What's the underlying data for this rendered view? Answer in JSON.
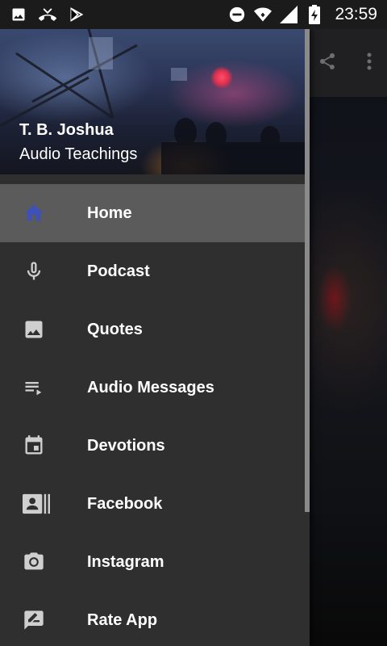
{
  "status_bar": {
    "time": "23:59",
    "left_icons": [
      "image-icon",
      "missed-call-icon",
      "play-store-icon"
    ],
    "right_icons": [
      "do-not-disturb-icon",
      "wifi-icon",
      "cell-signal-icon",
      "battery-charging-icon"
    ]
  },
  "drawer": {
    "header": {
      "title": "T. B. Joshua",
      "subtitle": "Audio Teachings"
    },
    "items": [
      {
        "label": "Home",
        "icon": "home-icon",
        "active": true
      },
      {
        "label": "Podcast",
        "icon": "microphone-icon",
        "active": false
      },
      {
        "label": "Quotes",
        "icon": "image-icon",
        "active": false
      },
      {
        "label": "Audio Messages",
        "icon": "playlist-play-icon",
        "active": false
      },
      {
        "label": "Devotions",
        "icon": "calendar-event-icon",
        "active": false
      },
      {
        "label": "Facebook",
        "icon": "contact-card-icon",
        "active": false
      },
      {
        "label": "Instagram",
        "icon": "camera-icon",
        "active": false
      },
      {
        "label": "Rate App",
        "icon": "rate-review-icon",
        "active": false
      }
    ]
  },
  "colors": {
    "active_icon": "#3f51b5",
    "drawer_bg": "#2f2f30",
    "active_row_bg": "#5b5b5c"
  }
}
